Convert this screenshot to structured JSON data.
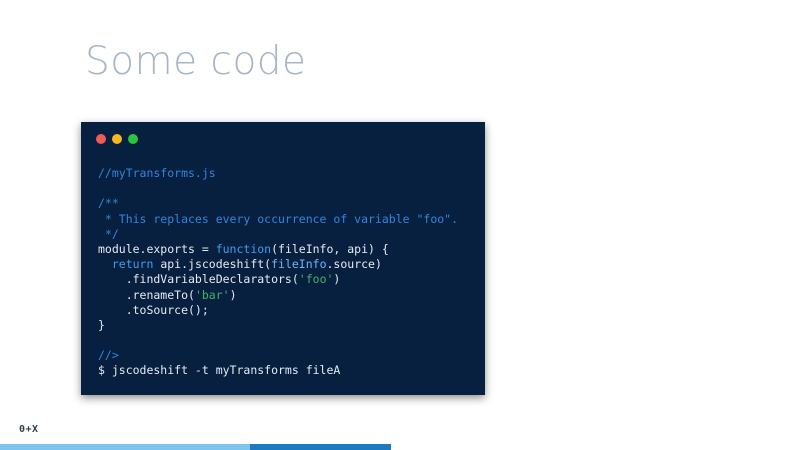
{
  "slide": {
    "title": "Some code"
  },
  "window_controls": {
    "close_color": "#f25a55",
    "minimize_color": "#f5b823",
    "maximize_color": "#2dc23f"
  },
  "code": {
    "line1": "//myTransforms.js",
    "line3": "/**",
    "line4": " * This replaces every occurrence of variable \"foo\".",
    "line5": " */",
    "line6_a": "module.exports = ",
    "line6_kw": "function",
    "line6_b": "(fileInfo, api) {",
    "line7_indent": "  ",
    "line7_kw": "return",
    "line7_a": " api.jscodeshift(",
    "line7_id": "fileInfo",
    "line7_b": ".source)",
    "line8_a": "    .findVariableDeclarators(",
    "line8_str": "'foo'",
    "line8_b": ")",
    "line9_a": "    .renameTo(",
    "line9_str": "'bar'",
    "line9_b": ")",
    "line10": "    .toSource();",
    "line11": "}",
    "line13": "//>",
    "line14": "$ jscodeshift -t myTransforms fileA"
  },
  "footer": {
    "logo": "0+X"
  },
  "progress": {
    "slide_fraction": 0.31,
    "colors": {
      "done": "#7dc4ef",
      "current": "#27a2ea",
      "rest": "#1e79c0"
    }
  }
}
